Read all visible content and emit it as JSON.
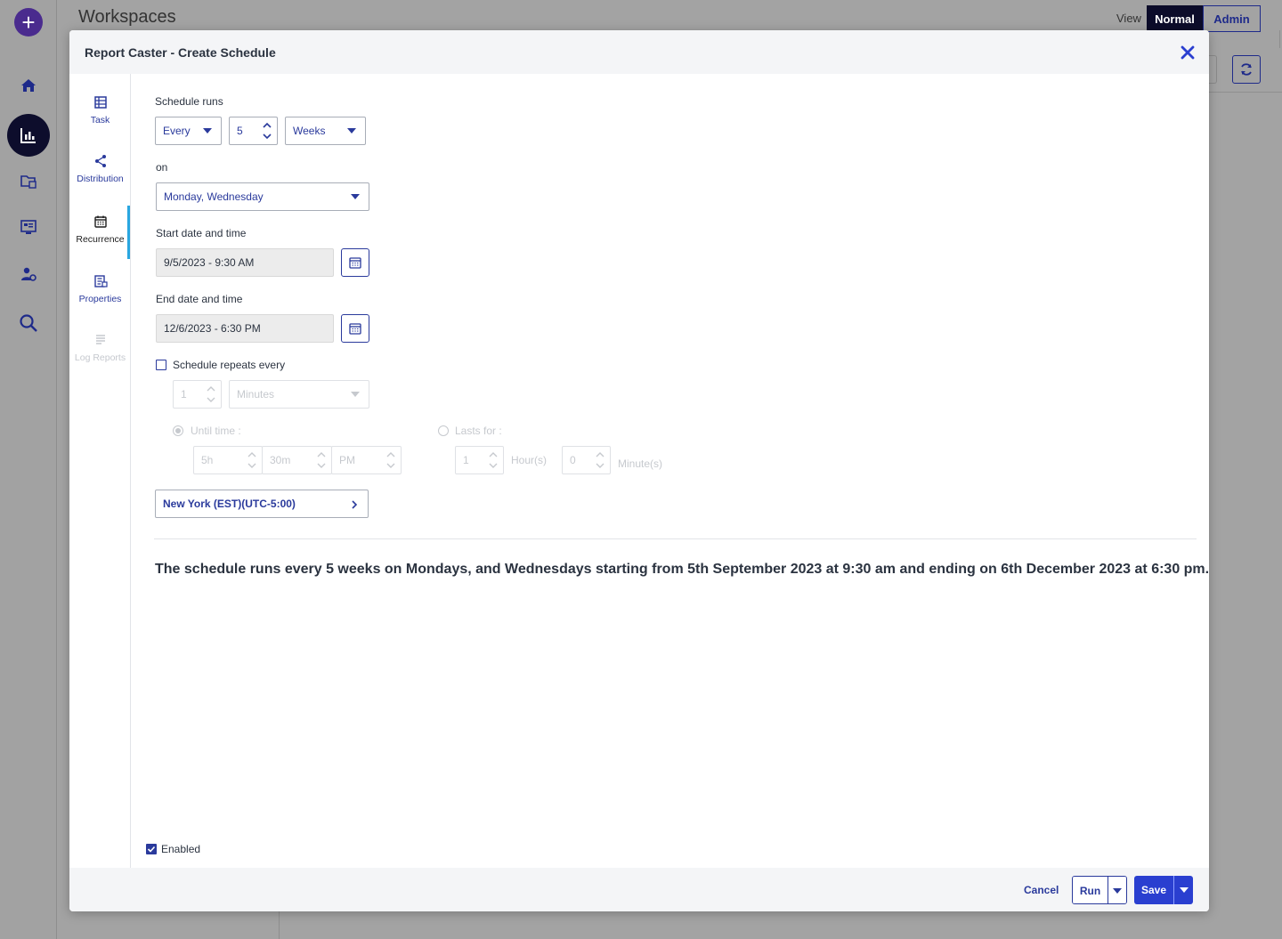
{
  "background": {
    "title": "Workspaces",
    "view_label": "View",
    "view_normal": "Normal",
    "view_admin": "Admin",
    "rail_icons": [
      "add-icon",
      "home-icon",
      "reports-icon",
      "folder-data-icon",
      "dashboard-icon",
      "user-settings-icon",
      "search-icon"
    ]
  },
  "modal": {
    "title": "Report Caster - Create Schedule",
    "nav": [
      {
        "label": "Task",
        "icon": "table-icon",
        "state": "enabled"
      },
      {
        "label": "Distribution",
        "icon": "share-icon",
        "state": "enabled"
      },
      {
        "label": "Recurrence",
        "icon": "calendar-icon",
        "state": "active"
      },
      {
        "label": "Properties",
        "icon": "properties-icon",
        "state": "enabled"
      },
      {
        "label": "Log Reports",
        "icon": "log-icon",
        "state": "disabled"
      }
    ],
    "schedule_runs_label": "Schedule runs",
    "frequency": "Every",
    "interval": "5",
    "unit": "Weeks",
    "on_label": "on",
    "days": "Monday, Wednesday",
    "start_label": "Start date and time",
    "start_value": "9/5/2023 - 9:30 AM",
    "end_label": "End date and time",
    "end_value": "12/6/2023 - 6:30 PM",
    "repeats_label": "Schedule repeats every",
    "repeats_checked": false,
    "repeat_count": "1",
    "repeat_unit": "Minutes",
    "until_label": "Until time :",
    "until_hour": "5h",
    "until_minute": "30m",
    "until_ampm": "PM",
    "lasts_label": "Lasts for :",
    "lasts_hours": "1",
    "hours_label": "Hour(s)",
    "lasts_minutes": "0",
    "minutes_label": "Minute(s)",
    "timezone": "New York (EST)(UTC-5:00)",
    "summary": "The schedule runs every 5 weeks on Mondays, and Wednesdays starting from 5th September 2023 at 9:30 am and ending on 6th December 2023 at 6:30 pm.",
    "enabled_label": "Enabled",
    "enabled_checked": true
  },
  "footer": {
    "cancel": "Cancel",
    "run": "Run",
    "save": "Save"
  },
  "colors": {
    "accent": "#2a3a9c",
    "primary_button": "#2a3fd0",
    "active_indicator": "#29a6e0",
    "overlay": "#a3a3a3"
  }
}
